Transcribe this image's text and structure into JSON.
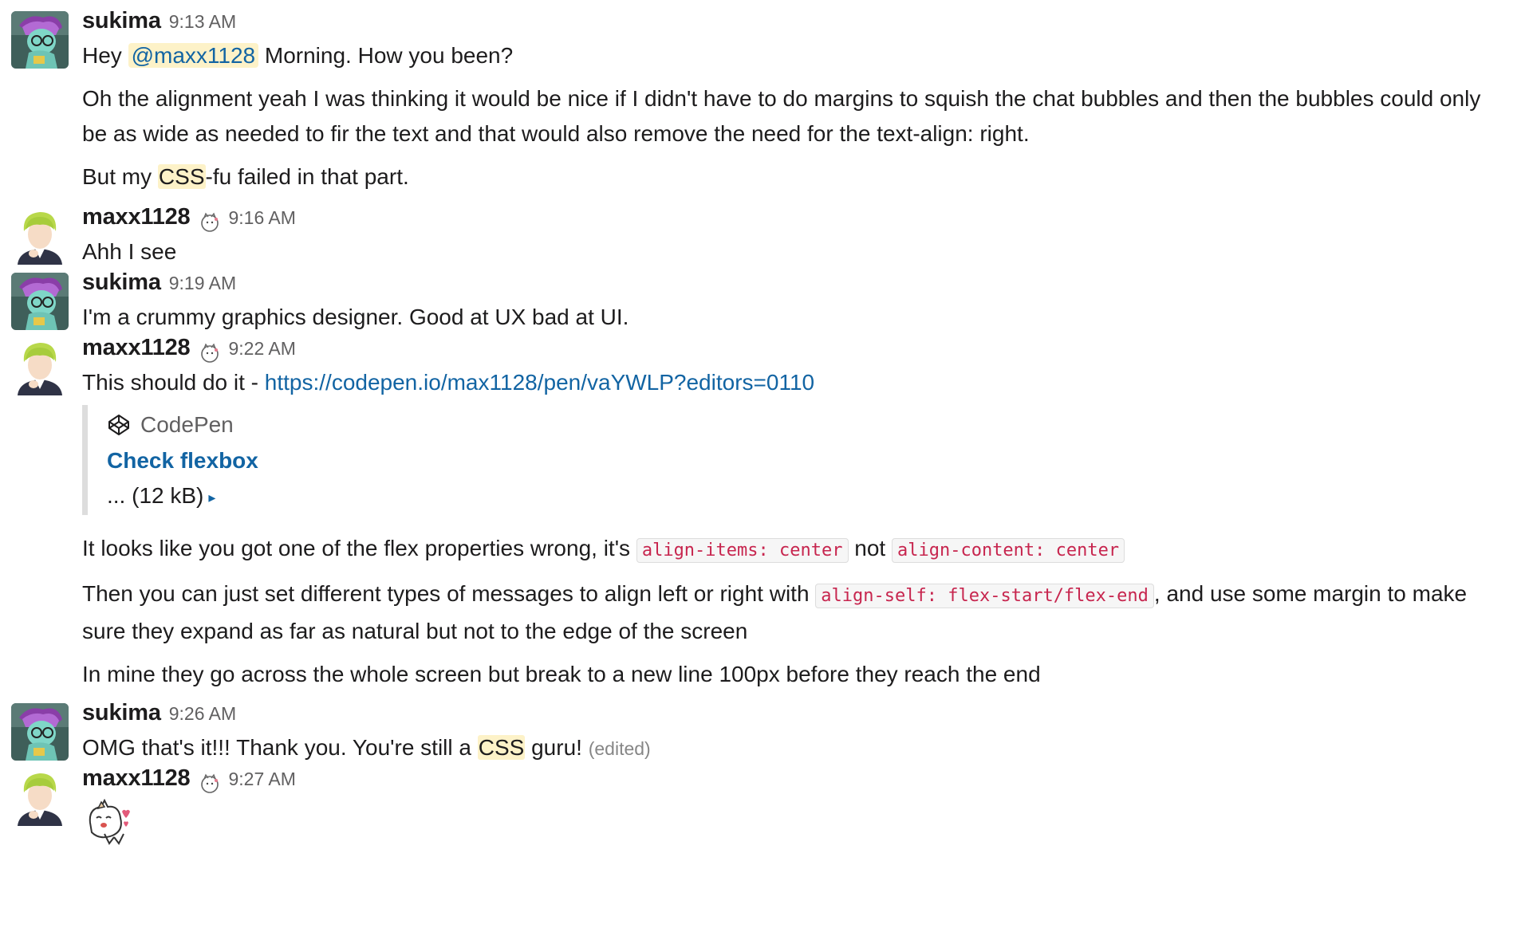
{
  "messages": [
    {
      "user": "sukima",
      "time": "9:13 AM",
      "line1_prefix": "Hey ",
      "line1_mention": "@maxx1128",
      "line1_suffix": " Morning. How you been?",
      "line2": "Oh the alignment yeah I was thinking it would be nice if I didn't have to do margins to squish the chat bubbles and then the bubbles could only be as wide as needed to fir the text and that would also remove the need for the text-align: right.",
      "line3_prefix": "But my ",
      "line3_hl": "CSS",
      "line3_suffix": "-fu failed in that part."
    },
    {
      "user": "maxx1128",
      "time": "9:16 AM",
      "text": "Ahh I see"
    },
    {
      "user": "sukima",
      "time": "9:19 AM",
      "text": "I'm a crummy graphics designer. Good at UX bad at UI."
    },
    {
      "user": "maxx1128",
      "time": "9:22 AM",
      "text_prefix": "This should do it - ",
      "link": "https://codepen.io/max1128/pen/vaYWLP?editors=0110",
      "unfurl": {
        "source": "CodePen",
        "title": "Check flexbox",
        "meta": "... (12 kB)",
        "caret": "▸"
      },
      "line2_prefix": "It looks like you got one of the flex properties wrong, it's ",
      "line2_code1": "align-items: center",
      "line2_mid": " not ",
      "line2_code2": "align-content: center",
      "line3_prefix": "Then you can just set different types of messages to align left or right with ",
      "line3_code": "align-self: flex-start/flex-end",
      "line3_suffix": ", and use some margin to make sure they expand as far as natural but not to the edge of the screen",
      "line4": "In mine they go across the whole screen but break to a new line 100px before they reach the end"
    },
    {
      "user": "sukima",
      "time": "9:26 AM",
      "text_prefix": "OMG that's it!!! Thank you. You're still a ",
      "text_hl": "CSS",
      "text_suffix": " guru! ",
      "edited": "(edited)"
    },
    {
      "user": "maxx1128",
      "time": "9:27 AM",
      "sticker": "cat-sticker"
    }
  ],
  "colors": {
    "link": "#1264a3",
    "mention_bg": "#fdf2c8",
    "code": "#c7254e",
    "timestamp": "#616061"
  }
}
